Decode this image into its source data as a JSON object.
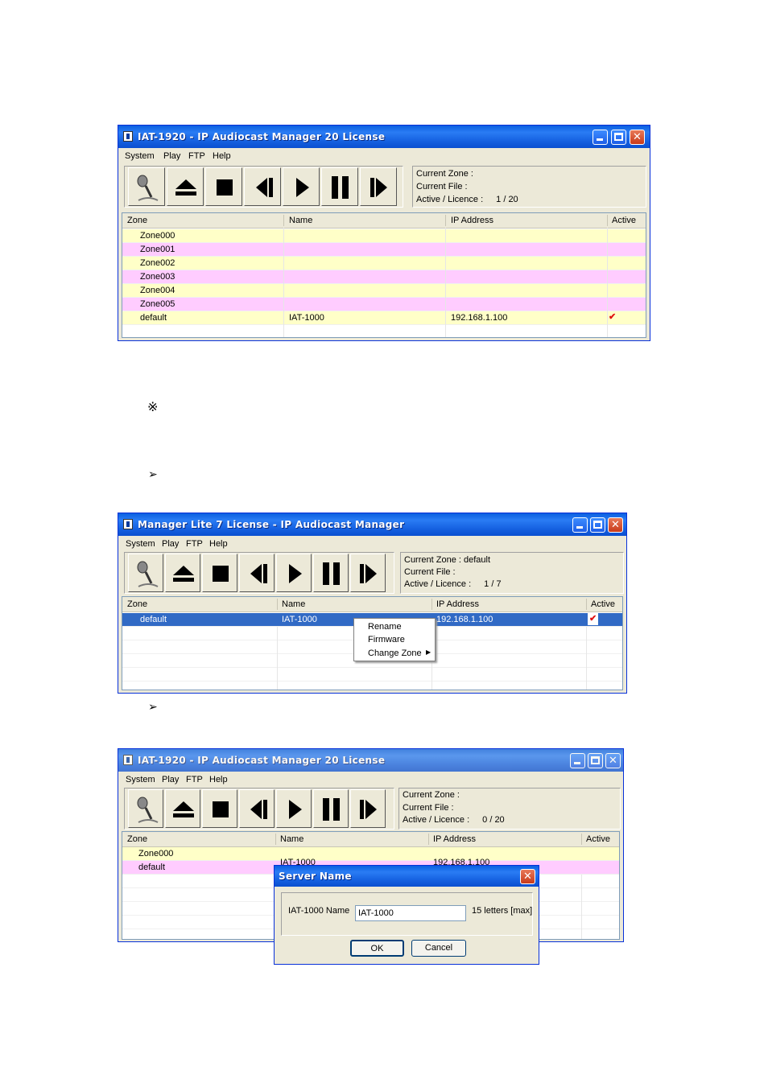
{
  "win1": {
    "title": "IAT-1920 - IP Audiocast Manager 20 License",
    "menu": [
      "System",
      "Play",
      "FTP",
      "Help"
    ],
    "status": {
      "zone_label": "Current Zone :",
      "zone_value": "",
      "file_label": "Current File :",
      "licence_label": "Active / Licence :",
      "licence_value": "1 /   20"
    },
    "columns": [
      "Zone",
      "Name",
      "IP Address",
      "Active"
    ],
    "rows": [
      {
        "zone": "Zone000",
        "name": "",
        "ip": "",
        "active": false,
        "color": "#ffffc8"
      },
      {
        "zone": "Zone001",
        "name": "",
        "ip": "",
        "active": false,
        "color": "#ffccff"
      },
      {
        "zone": "Zone002",
        "name": "",
        "ip": "",
        "active": false,
        "color": "#ffffc8"
      },
      {
        "zone": "Zone003",
        "name": "",
        "ip": "",
        "active": false,
        "color": "#ffccff"
      },
      {
        "zone": "Zone004",
        "name": "",
        "ip": "",
        "active": false,
        "color": "#ffffc8"
      },
      {
        "zone": "Zone005",
        "name": "",
        "ip": "",
        "active": false,
        "color": "#ffccff"
      },
      {
        "zone": "default",
        "name": "IAT-1000",
        "ip": "192.168.1.100",
        "active": true,
        "color": "#ffffc8"
      }
    ]
  },
  "note_symbol": "※",
  "arrow_symbol": "➢",
  "win2": {
    "title": "Manager Lite 7 License - IP Audiocast Manager",
    "menu": [
      "System",
      "Play",
      "FTP",
      "Help"
    ],
    "status": {
      "zone_label": "Current Zone :",
      "zone_value": "default",
      "file_label": "Current File :",
      "licence_label": "Active / Licence :",
      "licence_value": "1 /    7"
    },
    "columns": [
      "Zone",
      "Name",
      "IP Address",
      "Active"
    ],
    "rows": [
      {
        "zone": "default",
        "name": "IAT-1000",
        "ip": "192.168.1.100",
        "active": true,
        "selected": true
      }
    ],
    "context_menu": [
      "Rename",
      "Firmware",
      "Change Zone"
    ]
  },
  "win3": {
    "title": "IAT-1920 - IP Audiocast Manager 20 License",
    "menu": [
      "System",
      "Play",
      "FTP",
      "Help"
    ],
    "status": {
      "zone_label": "Current Zone :",
      "zone_value": "",
      "file_label": "Current File :",
      "licence_label": "Active / Licence :",
      "licence_value": "0 /   20"
    },
    "columns": [
      "Zone",
      "Name",
      "IP Address",
      "Active"
    ],
    "rows": [
      {
        "zone": "Zone000",
        "name": "",
        "ip": "",
        "color": "#ffffc8"
      },
      {
        "zone": "default",
        "name": "IAT-1000",
        "ip": "192.168.1.100",
        "color": "#ffccff"
      }
    ],
    "dialog": {
      "title": "Server Name",
      "field_label": "IAT-1000 Name",
      "field_value": "IAT-1000",
      "hint": "15 letters [max]",
      "ok": "OK",
      "cancel": "Cancel"
    }
  },
  "toolbar_icons": [
    "microphone-icon",
    "eject-icon",
    "stop-icon",
    "previous-icon",
    "play-icon",
    "pause-icon",
    "next-icon"
  ]
}
